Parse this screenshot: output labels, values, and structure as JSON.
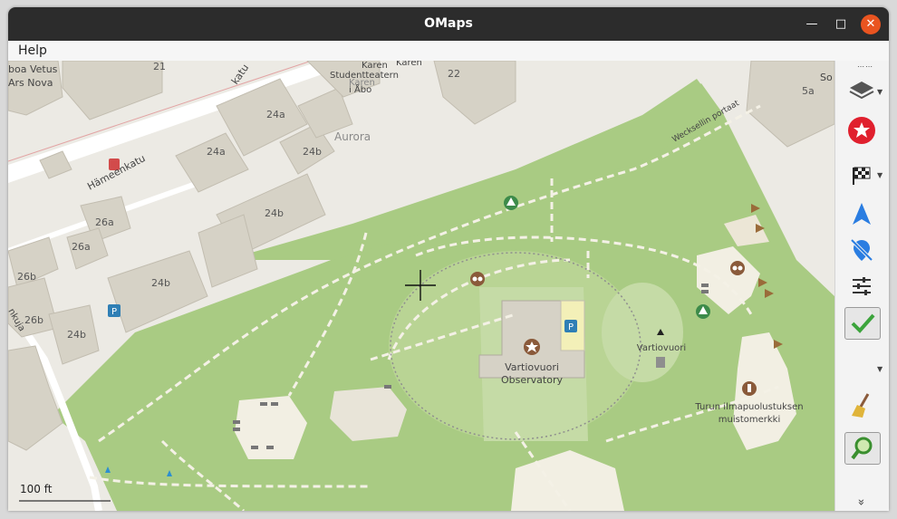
{
  "window": {
    "title": "OMaps",
    "minimize_glyph": "—",
    "maximize_glyph": "□",
    "close_glyph": "✕"
  },
  "menu": {
    "help": "Help"
  },
  "map": {
    "labels": {
      "street_hameenkatu": "Hämeenkatu",
      "street_katu_partial": "katu",
      "street_wecksell": "Wecksellin portaat",
      "street_kujja": "nkuja",
      "aurora": "Aurora",
      "boa_vetus_1": "boa Vetus",
      "boa_vetus_2": "Ars Nova",
      "studentteatern_1": "Studentteatern",
      "studentteatern_2": "i Åbo",
      "karen_1": "Karen",
      "karen_2": "Karen",
      "karen_3": "Karen",
      "observatory_1": "Vartiovuori",
      "observatory_2": "Observatory",
      "vartiovuori": "Vartiovuori",
      "memorial_1": "Turun ilmapuolustuksen",
      "memorial_2": "muistomerkki",
      "so_partial": "So"
    },
    "house_numbers": [
      "21",
      "22",
      "24a",
      "24a",
      "24b",
      "24b",
      "24b",
      "24b",
      "26a",
      "26a",
      "26b",
      "26b",
      "26b",
      "5a"
    ],
    "scale_label": "100 ft",
    "colors": {
      "park": "#a9cb83",
      "park_light": "#c5dba6",
      "building": "#d6d2c6",
      "building_border": "#c2bdb0",
      "ground": "#eceae4",
      "path": "#f4f1e6",
      "poi_green": "#3d8b4a",
      "poi_brown": "#8a5a3a",
      "parking": "#2f7fb5"
    }
  },
  "toolbar": {
    "layers_icon": "layers-icon",
    "bookmarks_icon": "star-icon",
    "route_icon": "checkered-flag-icon",
    "location_icon": "navigation-arrow-icon",
    "no_position_icon": "location-off-icon",
    "settings_icon": "sliders-icon",
    "check_icon": "checkmark-icon",
    "broom_icon": "broom-icon",
    "search_icon": "magnifier-icon",
    "more_glyph": "»"
  }
}
